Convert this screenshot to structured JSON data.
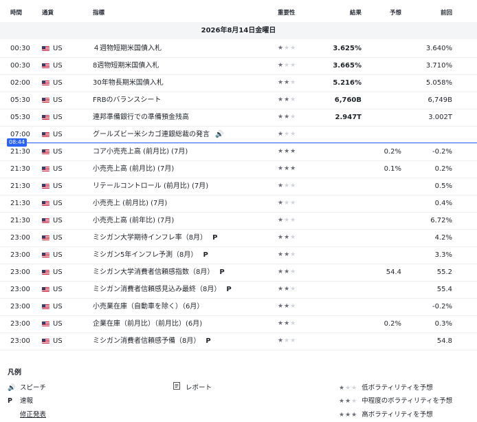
{
  "headers": {
    "time": "時間",
    "currency": "通貨",
    "indicator": "指標",
    "importance": "重要性",
    "actual": "結果",
    "forecast": "予想",
    "previous": "前回"
  },
  "date_label": "2026年8月14日金曜日",
  "now_time": "08:44",
  "rows": [
    {
      "time": "00:30",
      "currency": "US",
      "indicator": "４週物短期米国債入札",
      "stars": 1,
      "actual": "3.625%",
      "forecast": "",
      "previous": "3.640%",
      "mark": ""
    },
    {
      "time": "00:30",
      "currency": "US",
      "indicator": "8週物短期米国債入札",
      "stars": 1,
      "actual": "3.665%",
      "forecast": "",
      "previous": "3.710%",
      "mark": ""
    },
    {
      "time": "02:00",
      "currency": "US",
      "indicator": "30年物長期米国債入札",
      "stars": 2,
      "actual": "5.216%",
      "forecast": "",
      "previous": "5.058%",
      "mark": ""
    },
    {
      "time": "05:30",
      "currency": "US",
      "indicator": "FRBのバランスシート",
      "stars": 2,
      "actual": "6,760B",
      "forecast": "",
      "previous": "6,749B",
      "mark": ""
    },
    {
      "time": "05:30",
      "currency": "US",
      "indicator": "連邦準備銀行での準備預金残高",
      "stars": 2,
      "actual": "2.947T",
      "forecast": "",
      "previous": "3.002T",
      "mark": ""
    },
    {
      "time": "07:00",
      "currency": "US",
      "indicator": "グールズビー米シカゴ連銀総裁の発言",
      "stars": 1,
      "actual": "",
      "forecast": "",
      "previous": "",
      "mark": "speech"
    },
    {
      "time": "21:30",
      "currency": "US",
      "indicator": "コア小売売上高 (前月比) (7月)",
      "stars": 3,
      "actual": "",
      "forecast": "0.2%",
      "previous": "-0.2%",
      "mark": ""
    },
    {
      "time": "21:30",
      "currency": "US",
      "indicator": "小売売上高 (前月比) (7月)",
      "stars": 3,
      "actual": "",
      "forecast": "0.1%",
      "previous": "0.2%",
      "mark": ""
    },
    {
      "time": "21:30",
      "currency": "US",
      "indicator": "リテールコントロール (前月比) (7月)",
      "stars": 1,
      "actual": "",
      "forecast": "",
      "previous": "0.5%",
      "mark": ""
    },
    {
      "time": "21:30",
      "currency": "US",
      "indicator": "小売売上 (前月比) (7月)",
      "stars": 1,
      "actual": "",
      "forecast": "",
      "previous": "0.4%",
      "mark": ""
    },
    {
      "time": "21:30",
      "currency": "US",
      "indicator": "小売売上高 (前年比) (7月)",
      "stars": 1,
      "actual": "",
      "forecast": "",
      "previous": "6.72%",
      "mark": ""
    },
    {
      "time": "23:00",
      "currency": "US",
      "indicator": "ミシガン大学期待インフレ率（8月）",
      "stars": 2,
      "actual": "",
      "forecast": "",
      "previous": "4.2%",
      "mark": "P"
    },
    {
      "time": "23:00",
      "currency": "US",
      "indicator": "ミシガン5年インフレ予測（8月）",
      "stars": 2,
      "actual": "",
      "forecast": "",
      "previous": "3.3%",
      "mark": "P"
    },
    {
      "time": "23:00",
      "currency": "US",
      "indicator": "ミシガン大学消費者信頼感指数（8月）",
      "stars": 2,
      "actual": "",
      "forecast": "54.4",
      "previous": "55.2",
      "mark": "P"
    },
    {
      "time": "23:00",
      "currency": "US",
      "indicator": "ミシガン消費者信頼感見込み最終（8月）",
      "stars": 2,
      "actual": "",
      "forecast": "",
      "previous": "55.4",
      "mark": "P"
    },
    {
      "time": "23:00",
      "currency": "US",
      "indicator": "小売業在庫（自動車を除く）（6月）",
      "stars": 2,
      "actual": "",
      "forecast": "",
      "previous": "-0.2%",
      "mark": ""
    },
    {
      "time": "23:00",
      "currency": "US",
      "indicator": "企業在庫（前月比）（前月比）(6月)",
      "stars": 2,
      "actual": "",
      "forecast": "0.2%",
      "previous": "0.3%",
      "mark": ""
    },
    {
      "time": "23:00",
      "currency": "US",
      "indicator": "ミシガン消費者信頼感予備（8月）",
      "stars": 1,
      "actual": "",
      "forecast": "",
      "previous": "54.8",
      "mark": "P"
    }
  ],
  "legend": {
    "title": "凡例",
    "speech_icon": "🔊",
    "speech": "スピーチ",
    "report": "レポート",
    "flash_icon": "P",
    "flash": "速報",
    "revised": "修正発表",
    "low": "低ボラティリティを予想",
    "medium": "中程度のボラティリティを予想",
    "high": "高ボラティリティを予想"
  }
}
